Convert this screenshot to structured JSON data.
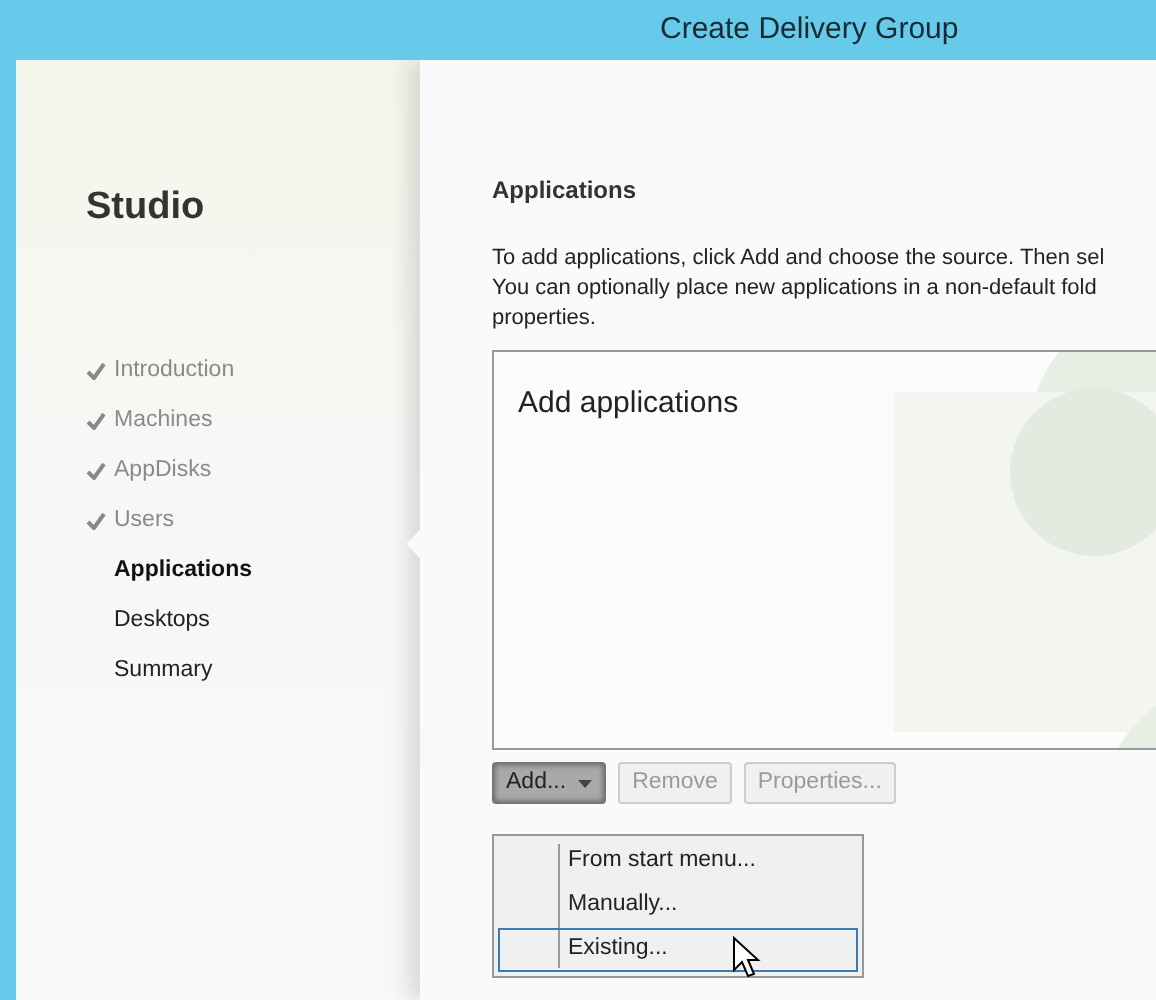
{
  "window": {
    "title": "Create Delivery Group"
  },
  "sidebar": {
    "title": "Studio",
    "items": [
      {
        "label": "Introduction",
        "completed": true,
        "selected": false
      },
      {
        "label": "Machines",
        "completed": true,
        "selected": false
      },
      {
        "label": "AppDisks",
        "completed": true,
        "selected": false
      },
      {
        "label": "Users",
        "completed": true,
        "selected": false
      },
      {
        "label": "Applications",
        "completed": false,
        "selected": true
      },
      {
        "label": "Desktops",
        "completed": false,
        "selected": false
      },
      {
        "label": "Summary",
        "completed": false,
        "selected": false
      }
    ]
  },
  "page": {
    "heading": "Applications",
    "description_lines": [
      "To add applications, click Add and choose the source. Then sel",
      "You can optionally place new applications in a non-default fold",
      "properties."
    ],
    "list_placeholder": "Add applications",
    "buttons": [
      {
        "label": "Add...",
        "kind": "dropdown",
        "disabled": false,
        "pressed": true
      },
      {
        "label": "Remove",
        "kind": "plain",
        "disabled": true,
        "pressed": false
      },
      {
        "label": "Properties...",
        "kind": "plain",
        "disabled": true,
        "pressed": false
      }
    ],
    "menu": [
      {
        "label": "From start menu...",
        "selected": false
      },
      {
        "label": "Manually...",
        "selected": false
      },
      {
        "label": "Existing...",
        "selected": true
      }
    ]
  }
}
